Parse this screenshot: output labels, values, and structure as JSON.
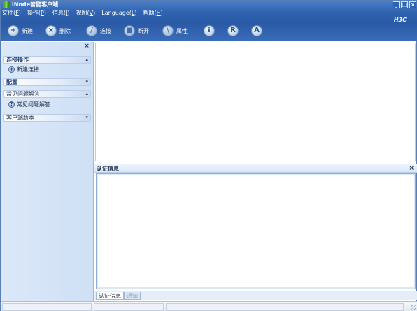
{
  "window": {
    "title": "iNode智能客户端",
    "buttons": [
      "_",
      "□",
      "×"
    ]
  },
  "menu": [
    {
      "label": "文件(",
      "key": "F",
      "suffix": ")"
    },
    {
      "label": "操作(",
      "key": "P",
      "suffix": ")"
    },
    {
      "label": "信息(",
      "key": "I",
      "suffix": ")"
    },
    {
      "label": "视图(",
      "key": "V",
      "suffix": ")"
    },
    {
      "label": "Language(",
      "key": "L",
      "suffix": ")"
    },
    {
      "label": "帮助(",
      "key": "H",
      "suffix": ")"
    }
  ],
  "brand": "H3C",
  "toolbar": {
    "new_label": "新建",
    "delete_label": "删除",
    "connect_label": "连接",
    "disconnect_label": "断开",
    "properties_label": "属性",
    "info_icon": "i",
    "r_icon": "R",
    "a_icon": "A"
  },
  "sidebar": {
    "close": "×",
    "sections": [
      {
        "title": "连接操作",
        "items": [
          {
            "label": "新建连接",
            "icon": "add-icon"
          }
        ]
      },
      {
        "title": "配置",
        "items": []
      },
      {
        "title": "常见问题解答",
        "items": [
          {
            "label": "常见问题解答",
            "icon": "help-icon"
          }
        ]
      },
      {
        "title": "客户端版本",
        "items": []
      }
    ],
    "chevron": "▴",
    "chevron_down": "▾"
  },
  "auth_panel": {
    "title": "认证信息",
    "close": "×",
    "tabs": [
      "认证信息",
      "通知"
    ]
  },
  "colors": {
    "chrome": "#2e62b0",
    "sidebar": "#d6e4f7",
    "accent": "#1d3f7a"
  }
}
